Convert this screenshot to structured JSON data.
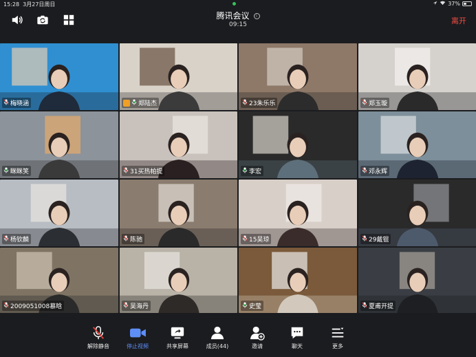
{
  "status": {
    "time": "15:28",
    "date": "3月27日周日",
    "battery": "37%",
    "battery_level": 0.37
  },
  "header": {
    "title": "腾讯会议",
    "timer": "09:15",
    "leave_label": "离开"
  },
  "tiles": [
    {
      "name": "梅晓涵",
      "mic": "muted"
    },
    {
      "name": "郑陆杰",
      "mic": "on",
      "host": true,
      "active": true
    },
    {
      "name": "23朱乐乐",
      "mic": "muted"
    },
    {
      "name": "郑玉璇",
      "mic": "muted"
    },
    {
      "name": "眯眯笑",
      "mic": "on"
    },
    {
      "name": "31买热帕提",
      "mic": "muted"
    },
    {
      "name": "李宏",
      "mic": "on"
    },
    {
      "name": "邓永辉",
      "mic": "muted"
    },
    {
      "name": "杨钦麟",
      "mic": "muted"
    },
    {
      "name": "陈驰",
      "mic": "muted"
    },
    {
      "name": "15吴琼",
      "mic": "muted"
    },
    {
      "name": "29戴锟",
      "mic": "muted"
    },
    {
      "name": "2009051008慕晗",
      "mic": "muted"
    },
    {
      "name": "吴海丹",
      "mic": "muted"
    },
    {
      "name": "史莹",
      "mic": "on"
    },
    {
      "name": "夏甫开提",
      "mic": "muted"
    }
  ],
  "toolbar": [
    {
      "label": "解除静音",
      "icon": "mic-muted-icon"
    },
    {
      "label": "停止视频",
      "icon": "video-camera-icon"
    },
    {
      "label": "共享屏幕",
      "icon": "share-screen-icon"
    },
    {
      "label": "成员(44)",
      "icon": "members-icon"
    },
    {
      "label": "邀请",
      "icon": "invite-icon"
    },
    {
      "label": "聊天",
      "icon": "chat-icon"
    },
    {
      "label": "更多",
      "icon": "more-icon"
    }
  ],
  "colors": {
    "accent": "#5e8ef7",
    "leave": "#f24b43",
    "active_border": "#35c35a",
    "background": "#1b1c1f"
  }
}
